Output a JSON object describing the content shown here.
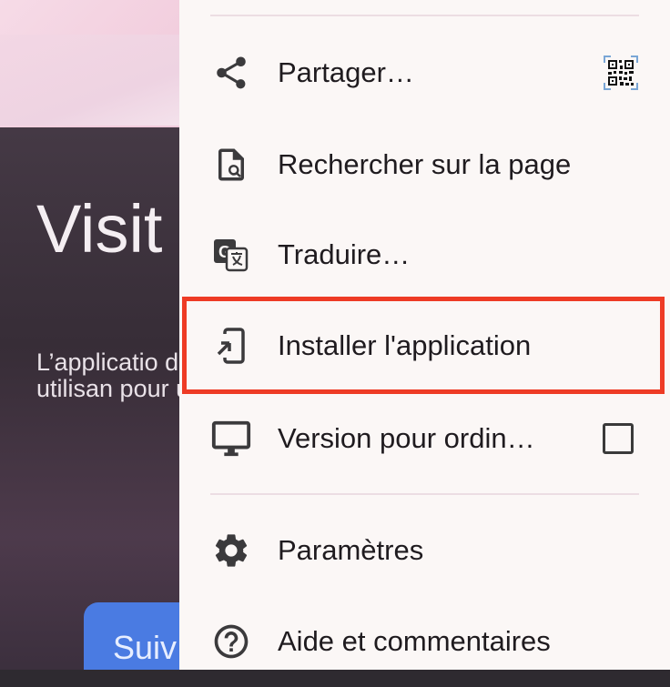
{
  "page": {
    "title": "Visit camp",
    "description": "L’applicatio de la uni physiquem en utilisan pour une l'université",
    "cta_label": "Suiv"
  },
  "menu": {
    "items": [
      {
        "label": "Partager…",
        "icon": "share-icon",
        "trailing": "qr-code-icon"
      },
      {
        "label": "Rechercher sur la page",
        "icon": "find-in-page-icon"
      },
      {
        "label": "Traduire…",
        "icon": "translate-icon"
      },
      {
        "label": "Installer l'application",
        "icon": "install-app-icon",
        "highlighted": true
      },
      {
        "label": "Version pour ordin…",
        "icon": "desktop-icon",
        "trailing": "checkbox",
        "checked": false
      },
      {
        "label": "Paramètres",
        "icon": "gear-icon"
      },
      {
        "label": "Aide et commentaires",
        "icon": "help-icon"
      }
    ]
  },
  "colors": {
    "menu_background": "#fbf7f6",
    "highlight_border": "#ee3b25",
    "cta_background": "#4a7be2"
  }
}
